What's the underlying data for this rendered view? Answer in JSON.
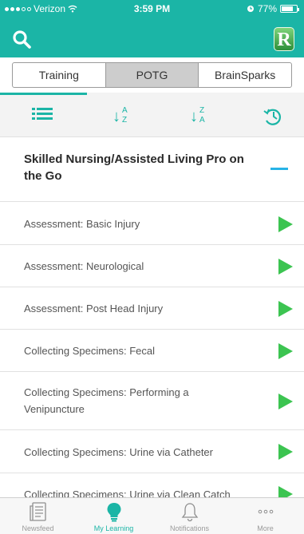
{
  "status_bar": {
    "carrier": "Verizon",
    "time": "3:59 PM",
    "battery": "77%",
    "battery_level": 0.77
  },
  "header": {
    "search_icon": "search-icon",
    "logo_letter": "R"
  },
  "segments": [
    {
      "label": "Training",
      "active": false
    },
    {
      "label": "POTG",
      "active": true
    },
    {
      "label": "BrainSparks",
      "active": false
    }
  ],
  "sort_bar": {
    "buttons": [
      "list-view-icon",
      "sort-a-z-icon",
      "sort-z-a-icon",
      "recent-history-icon"
    ],
    "az": {
      "top": "A",
      "bottom": "Z"
    },
    "za": {
      "top": "Z",
      "bottom": "A"
    }
  },
  "section": {
    "title": "Skilled Nursing/Assisted Living Pro on the Go"
  },
  "items": [
    {
      "label": "Assessment: Basic Injury"
    },
    {
      "label": "Assessment: Neurological"
    },
    {
      "label": "Assessment: Post Head Injury"
    },
    {
      "label": "Collecting Specimens: Fecal"
    },
    {
      "label": "Collecting Specimens: Performing a Venipuncture"
    },
    {
      "label": "Collecting Specimens: Urine via Catheter"
    },
    {
      "label": "Collecting Specimens: Urine via Clean Catch"
    }
  ],
  "tabs": [
    {
      "label": "Newsfeed",
      "icon": "newsfeed-icon",
      "active": false
    },
    {
      "label": "My Learning",
      "icon": "lightbulb-icon",
      "active": true
    },
    {
      "label": "Notifications",
      "icon": "bell-icon",
      "active": false
    },
    {
      "label": "More",
      "icon": "more-icon",
      "active": false
    }
  ],
  "colors": {
    "brand_teal": "#1bb5a6",
    "play_green": "#3cc451",
    "collapse_blue": "#27b3e6"
  }
}
